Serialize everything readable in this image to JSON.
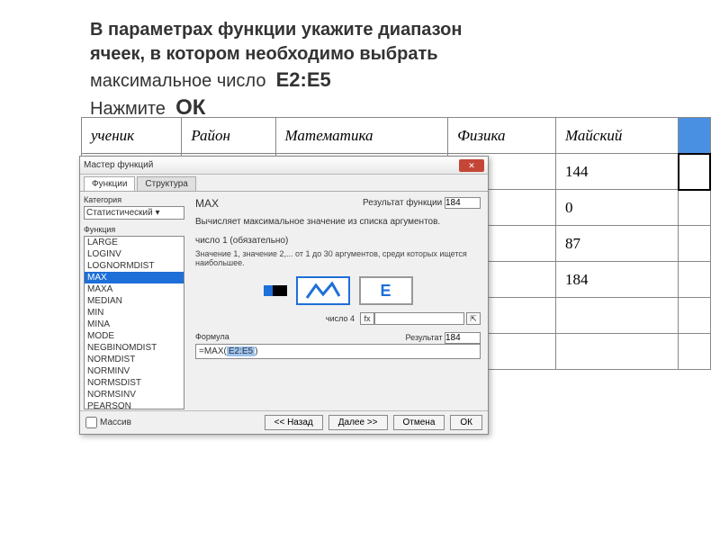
{
  "instruction": {
    "line1a": "В параметрах функции укажите диапазон",
    "line1b": "ячеек, в котором необходимо выбрать",
    "line2a": "максимальное число",
    "range": "Е2:Е5",
    "line3a": "Нажмите",
    "ok": "ОК"
  },
  "sheet": {
    "headers": [
      "ученик",
      "Район",
      "Математика",
      "Физика",
      "Майский",
      ""
    ],
    "rows": [
      [
        "",
        "",
        "",
        "",
        "144",
        ""
      ],
      [
        "",
        "",
        "",
        "",
        "0",
        ""
      ],
      [
        "",
        "",
        "",
        "",
        "87",
        ""
      ],
      [
        "",
        "",
        "",
        "",
        "184",
        ""
      ],
      [
        "",
        "",
        "",
        "",
        "",
        ""
      ],
      [
        "",
        "",
        "",
        "",
        "",
        ""
      ]
    ]
  },
  "dialog": {
    "title": "Мастер функций",
    "closeGlyph": "✕",
    "tabs": [
      "Функции",
      "Структура"
    ],
    "categoryLabel": "Категория",
    "category": "Статистический",
    "functionLabel": "Функция",
    "functions": [
      "LARGE",
      "LOGINV",
      "LOGNORMDIST",
      "MAX",
      "MAXA",
      "MEDIAN",
      "MIN",
      "MINA",
      "MODE",
      "NEGBINOMDIST",
      "NORMDIST",
      "NORMINV",
      "NORMSDIST",
      "NORMSINV",
      "PEARSON"
    ],
    "selectedFunction": "MAX",
    "funcName": "MAX",
    "resultLabel": "Результат функции",
    "resultVal": "184",
    "desc": "Вычисляет максимальное значение из списка аргументов.",
    "argTitle": "число 1 (обязательно)",
    "argDesc": "Значение 1, значение 2,... от 1 до 30 аргументов, среди которых ищется наибольшее.",
    "arg4Label": "число 4",
    "fx": "fx",
    "formulaLabel": "Формула",
    "result2Label": "Результат",
    "result2Val": "184",
    "formulaPrefix": "=MAX(",
    "formulaRange": "E2:E5",
    "formulaSuffix": ")",
    "massiv": "Массив",
    "btnBack": "<< Назад",
    "btnNext": "Далее >>",
    "btnCancel": "Отмена",
    "btnOk": "ОК",
    "thumbE": "E"
  }
}
